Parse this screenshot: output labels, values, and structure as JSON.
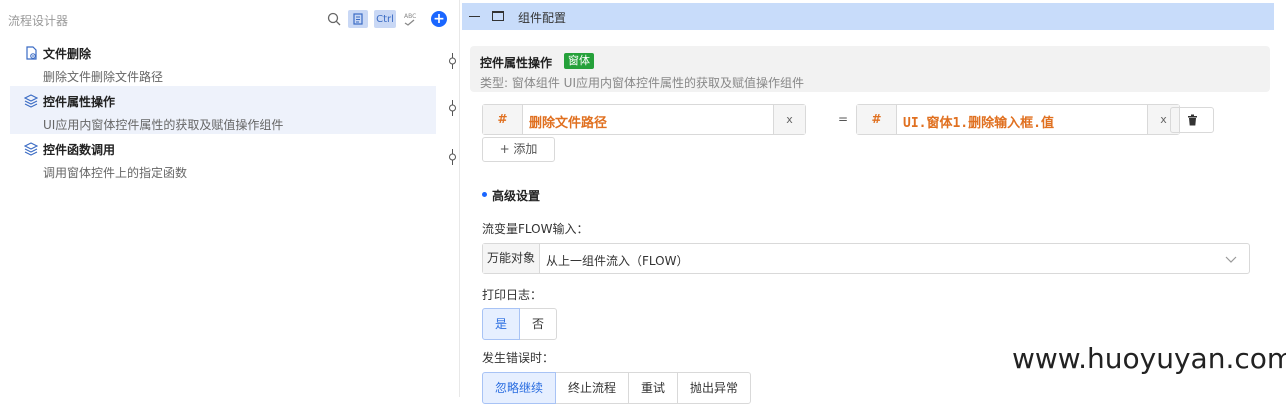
{
  "left_panel": {
    "title": "流程设计器",
    "toolbar": {
      "ctrl_label": "Ctrl",
      "icons": [
        "search-icon",
        "document-icon",
        "ctrl-icon",
        "spellcheck-icon",
        "add-icon"
      ]
    },
    "items": [
      {
        "icon": "file-delete-icon",
        "title": "文件删除",
        "desc": "删除文件删除文件路径",
        "selected": false
      },
      {
        "icon": "layers-icon",
        "title": "控件属性操作",
        "desc": "UI应用内窗体控件属性的获取及赋值操作组件",
        "selected": true
      },
      {
        "icon": "layers-icon",
        "title": "控件函数调用",
        "desc": "调用窗体控件上的指定函数",
        "selected": false
      }
    ]
  },
  "right_panel": {
    "header_title": "组件配置",
    "info": {
      "title": "控件属性操作",
      "tag": "窗体",
      "type_text": "类型:  窗体组件 UI应用内窗体控件属性的获取及赋值操作组件"
    },
    "assignment": {
      "left": {
        "hash": "#",
        "value": "删除文件路径",
        "clear": "x"
      },
      "equals": "=",
      "right": {
        "hash": "#",
        "value": "UI.窗体1.删除输入框.值",
        "clear": "x"
      }
    },
    "add_label": "+ 添加",
    "advanced_title": "高级设置",
    "flow_label": "流变量FLOW输入：",
    "flow_select": {
      "prefix": "万能对象",
      "value": "从上一组件流入（FLOW）"
    },
    "log_label": "打印日志：",
    "log_options": [
      {
        "label": "是",
        "active": true
      },
      {
        "label": "否",
        "active": false
      }
    ],
    "error_label": "发生错误时：",
    "error_options": [
      {
        "label": "忽略继续",
        "active": true
      },
      {
        "label": "终止流程",
        "active": false
      },
      {
        "label": "重试",
        "active": false
      },
      {
        "label": "抛出异常",
        "active": false
      }
    ]
  },
  "watermark": "www.huoyuyan.com",
  "colors": {
    "accent": "#1a66ff",
    "header_bg": "#c8dcfa",
    "tag_green": "#25a13a",
    "value_orange": "#e07020"
  }
}
